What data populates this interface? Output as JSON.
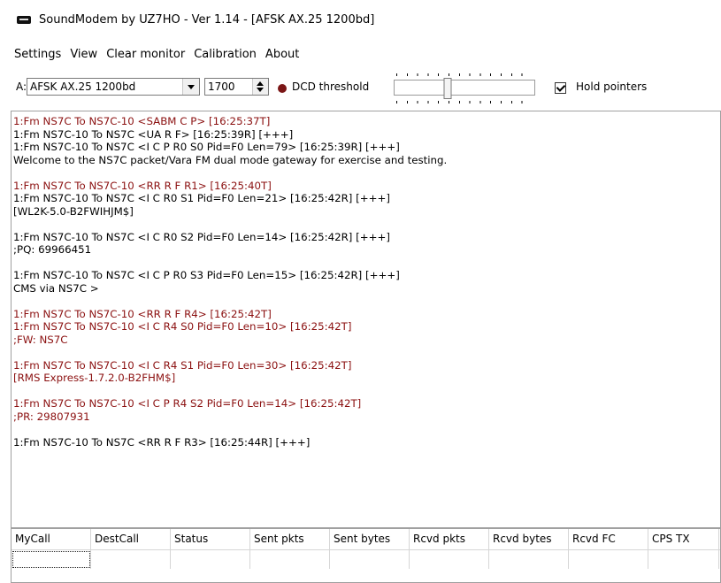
{
  "window": {
    "title": "SoundModem by UZ7HO - Ver 1.14 - [AFSK AX.25 1200bd]",
    "icon": "modem-icon"
  },
  "menu": [
    "Settings",
    "View",
    "Clear monitor",
    "Calibration",
    "About"
  ],
  "toolbar": {
    "channel_label": "A:",
    "modem_value": "AFSK AX.25 1200bd",
    "frequency": "1700",
    "dcd_label": "DCD threshold",
    "dcd_level_fraction": 0.38,
    "led_color": "#7b1616",
    "hold_pointers_label": "Hold pointers",
    "hold_pointers_checked": true
  },
  "colors": {
    "tx": "#8b1010",
    "rx": "#000000"
  },
  "monitor": {
    "lines": [
      {
        "text": "1:Fm NS7C To NS7C-10 <SABM C P> [16:25:37T]",
        "kind": "tx"
      },
      {
        "text": "1:Fm NS7C-10 To NS7C <UA R F> [16:25:39R] [+++]",
        "kind": "rx"
      },
      {
        "text": "1:Fm NS7C-10 To NS7C <I C P R0 S0 Pid=F0 Len=79> [16:25:39R] [+++]",
        "kind": "rx"
      },
      {
        "text": "Welcome to the NS7C packet/Vara FM dual mode gateway for exercise and testing.",
        "kind": "rx"
      },
      {
        "text": "",
        "kind": "gap"
      },
      {
        "text": "1:Fm NS7C To NS7C-10 <RR R F R1> [16:25:40T]",
        "kind": "tx"
      },
      {
        "text": "1:Fm NS7C-10 To NS7C <I C R0 S1 Pid=F0 Len=21> [16:25:42R] [+++]",
        "kind": "rx"
      },
      {
        "text": "[WL2K-5.0-B2FWIHJM$]",
        "kind": "rx"
      },
      {
        "text": "",
        "kind": "gap"
      },
      {
        "text": "1:Fm NS7C-10 To NS7C <I C R0 S2 Pid=F0 Len=14> [16:25:42R] [+++]",
        "kind": "rx"
      },
      {
        "text": ";PQ: 69966451",
        "kind": "rx"
      },
      {
        "text": "",
        "kind": "gap"
      },
      {
        "text": "1:Fm NS7C-10 To NS7C <I C P R0 S3 Pid=F0 Len=15> [16:25:42R] [+++]",
        "kind": "rx"
      },
      {
        "text": "CMS via NS7C >",
        "kind": "rx"
      },
      {
        "text": "",
        "kind": "gap"
      },
      {
        "text": "1:Fm NS7C To NS7C-10 <RR R F R4> [16:25:42T]",
        "kind": "tx"
      },
      {
        "text": "1:Fm NS7C To NS7C-10 <I C R4 S0 Pid=F0 Len=10> [16:25:42T]",
        "kind": "tx"
      },
      {
        "text": ";FW: NS7C",
        "kind": "tx"
      },
      {
        "text": "",
        "kind": "gap"
      },
      {
        "text": "1:Fm NS7C To NS7C-10 <I C R4 S1 Pid=F0 Len=30> [16:25:42T]",
        "kind": "tx"
      },
      {
        "text": "[RMS Express-1.7.2.0-B2FHM$]",
        "kind": "tx"
      },
      {
        "text": "",
        "kind": "gap"
      },
      {
        "text": "1:Fm NS7C To NS7C-10 <I C P R4 S2 Pid=F0 Len=14> [16:25:42T]",
        "kind": "tx"
      },
      {
        "text": ";PR: 29807931",
        "kind": "tx"
      },
      {
        "text": "",
        "kind": "gap"
      },
      {
        "text": "1:Fm NS7C-10 To NS7C <RR R F R3> [16:25:44R] [+++]",
        "kind": "rx"
      }
    ]
  },
  "stats_table": {
    "columns": [
      "MyCall",
      "DestCall",
      "Status",
      "Sent pkts",
      "Sent bytes",
      "Rcvd pkts",
      "Rcvd bytes",
      "Rcvd FC",
      "CPS TX"
    ]
  }
}
